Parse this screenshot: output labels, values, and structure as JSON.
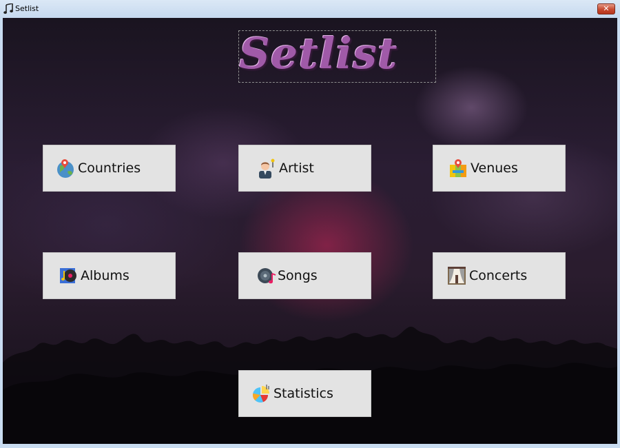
{
  "window": {
    "title": "Setlist",
    "close_glyph": "✕"
  },
  "logo": {
    "text": "Setlist"
  },
  "buttons": {
    "countries": {
      "label": "Countries",
      "icon": "globe-pin-icon"
    },
    "artist": {
      "label": "Artist",
      "icon": "artist-person-icon"
    },
    "venues": {
      "label": "Venues",
      "icon": "map-venue-icon"
    },
    "albums": {
      "label": "Albums",
      "icon": "album-icon"
    },
    "songs": {
      "label": "Songs",
      "icon": "vinyl-note-icon"
    },
    "concerts": {
      "label": "Concerts",
      "icon": "stage-curtain-icon"
    },
    "statistics": {
      "label": "Statistics",
      "icon": "pie-chart-icon"
    }
  },
  "colors": {
    "button_bg": "#e3e3e3",
    "logo": "#a05aa8",
    "close_button": "#c74a31"
  }
}
